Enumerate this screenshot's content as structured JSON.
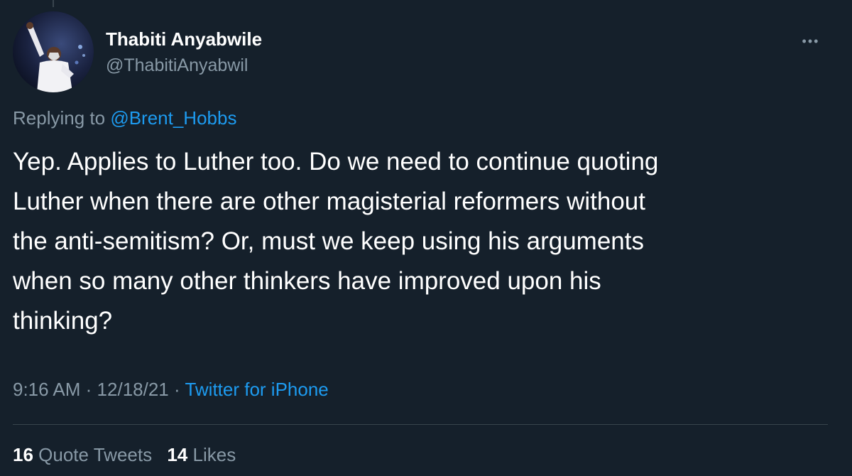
{
  "tweet": {
    "author": {
      "display_name": "Thabiti Anyabwile",
      "handle": "@ThabitiAnyabwil"
    },
    "more_icon": "ellipsis-icon",
    "replying_prefix": "Replying to",
    "replying_to": "@Brent_Hobbs",
    "text_lines": [
      "Yep. Applies to Luther too. Do we need to continue quoting",
      "Luther when there are other magisterial reformers without",
      "the anti-semitism? Or, must we keep using his arguments",
      "when so many other thinkers have improved upon his",
      "thinking?"
    ],
    "time": "9:16 AM",
    "date": "12/18/21",
    "separator": "·",
    "source": "Twitter for iPhone",
    "stats": {
      "quote_tweets_count": "16",
      "quote_tweets_label": "Quote Tweets",
      "likes_count": "14",
      "likes_label": "Likes"
    }
  },
  "colors": {
    "background": "#15202b",
    "text": "#ffffff",
    "secondary_text": "#8899a6",
    "link": "#1d9bf0",
    "divider": "#38444d"
  }
}
